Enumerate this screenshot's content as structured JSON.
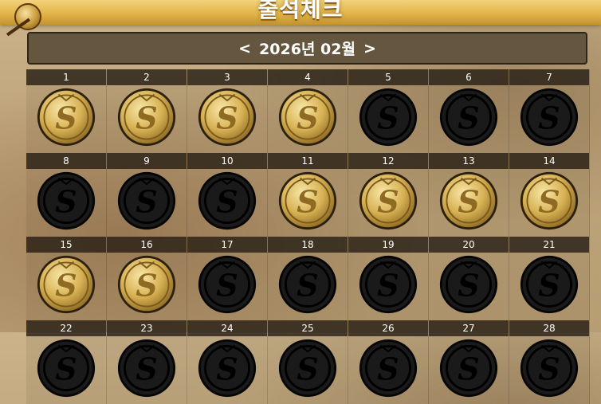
{
  "page": {
    "title": "출석체크",
    "month_label": "2026년 02월",
    "prev_label": "<",
    "next_label": ">"
  },
  "days": [
    {
      "day": "1",
      "checked": true
    },
    {
      "day": "2",
      "checked": true
    },
    {
      "day": "3",
      "checked": true
    },
    {
      "day": "4",
      "checked": true
    },
    {
      "day": "5",
      "checked": false
    },
    {
      "day": "6",
      "checked": false
    },
    {
      "day": "7",
      "checked": false
    },
    {
      "day": "8",
      "checked": false
    },
    {
      "day": "9",
      "checked": false
    },
    {
      "day": "10",
      "checked": false
    },
    {
      "day": "11",
      "checked": true
    },
    {
      "day": "12",
      "checked": true
    },
    {
      "day": "13",
      "checked": true
    },
    {
      "day": "14",
      "checked": true
    },
    {
      "day": "15",
      "checked": true
    },
    {
      "day": "16",
      "checked": true
    },
    {
      "day": "17",
      "checked": false
    },
    {
      "day": "18",
      "checked": false
    },
    {
      "day": "19",
      "checked": false
    },
    {
      "day": "20",
      "checked": false
    },
    {
      "day": "21",
      "checked": false
    },
    {
      "day": "22",
      "checked": false
    },
    {
      "day": "23",
      "checked": false
    },
    {
      "day": "24",
      "checked": false
    },
    {
      "day": "25",
      "checked": false
    },
    {
      "day": "26",
      "checked": false
    },
    {
      "day": "27",
      "checked": false
    },
    {
      "day": "28",
      "checked": false
    }
  ],
  "colors": {
    "gold_coin": "#d8b254",
    "black_coin": "#111111",
    "banner": "#e2b54a",
    "month_bar": "#64563f"
  },
  "icons": {
    "checked": "gold-s-coin-icon",
    "unchecked": "black-s-coin-icon"
  }
}
